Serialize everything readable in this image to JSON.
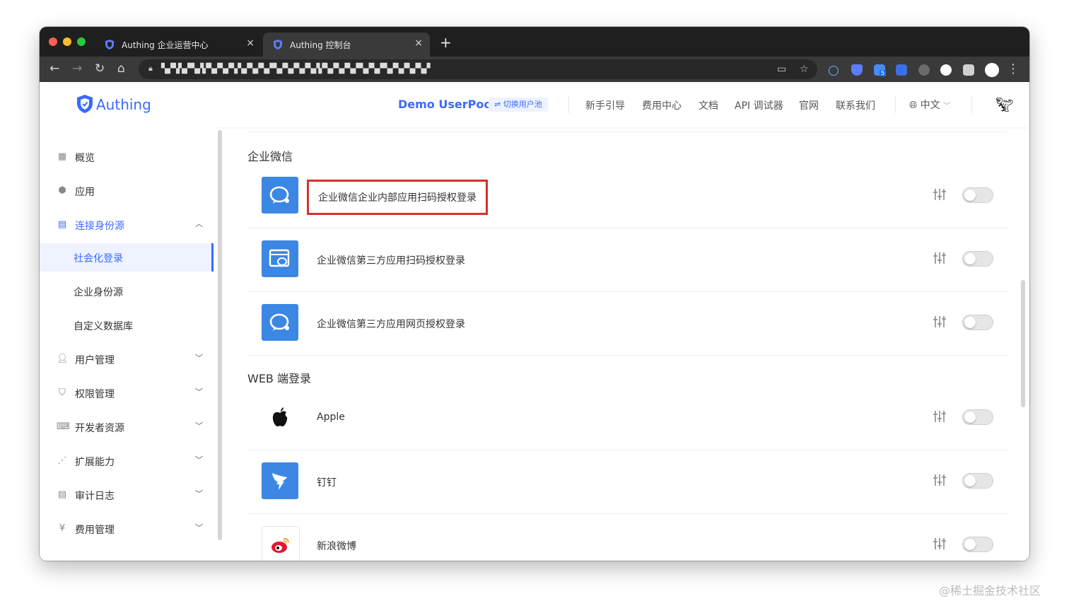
{
  "browser": {
    "tabs": [
      {
        "label": "Authing 企业运营中心",
        "close": "×"
      },
      {
        "label": "Authing 控制台",
        "close": "×"
      }
    ],
    "new_tab": "+",
    "nav": {
      "back": "←",
      "forward": "→",
      "reload": "↻",
      "home": "⌂"
    },
    "url_masked": "▚▞▚▚▞ ▚▞▞▚▞▚▞▚ ▚▞▚▞▚▞ ▚▞▚▞▚▞▚▞▞▚▞▚▞▚▞ ▚▞▚▞ ▚▞▚▞▚▞▚▞",
    "menu": "⋮",
    "extension_badge": "5"
  },
  "header": {
    "logo_text": "Authing",
    "userpool": "Demo UserPool",
    "switch_pool": "⇌ 切换用户池",
    "nav": [
      "新手引导",
      "费用中心",
      "文档",
      "API 调试器",
      "官网",
      "联系我们"
    ],
    "language": "中文"
  },
  "sidebar": {
    "items": [
      {
        "label": "概览",
        "icon": "dashboard-icon"
      },
      {
        "label": "应用",
        "icon": "cube-icon"
      },
      {
        "label": "连接身份源",
        "icon": "id-card-icon",
        "expanded": true
      },
      {
        "label": "用户管理",
        "icon": "user-icon"
      },
      {
        "label": "权限管理",
        "icon": "shield-icon"
      },
      {
        "label": "开发者资源",
        "icon": "code-icon"
      },
      {
        "label": "扩展能力",
        "icon": "share-icon"
      },
      {
        "label": "审计日志",
        "icon": "log-icon"
      },
      {
        "label": "费用管理",
        "icon": "yen-icon"
      }
    ],
    "subitems": [
      {
        "label": "社会化登录",
        "selected": true
      },
      {
        "label": "企业身份源"
      },
      {
        "label": "自定义数据库"
      }
    ]
  },
  "main": {
    "sections": [
      {
        "title": "企业微信",
        "providers": [
          {
            "name": "企业微信企业内部应用扫码授权登录",
            "icon": "wecom-icon",
            "enabled": false
          },
          {
            "name": "企业微信第三方应用扫码授权登录",
            "icon": "wecom-window-icon",
            "enabled": false
          },
          {
            "name": "企业微信第三方应用网页授权登录",
            "icon": "wecom-icon",
            "enabled": false
          }
        ]
      },
      {
        "title": "WEB 端登录",
        "providers": [
          {
            "name": "Apple",
            "icon": "apple-icon",
            "enabled": false
          },
          {
            "name": "钉钉",
            "icon": "dingtalk-icon",
            "enabled": false
          },
          {
            "name": "新浪微博",
            "icon": "weibo-icon",
            "enabled": false
          }
        ]
      }
    ]
  },
  "watermark": "@稀土掘金技术社区",
  "colors": {
    "accent": "#396aff",
    "highlight_border": "#d4322c",
    "provider_blue": "#3c87e4"
  }
}
